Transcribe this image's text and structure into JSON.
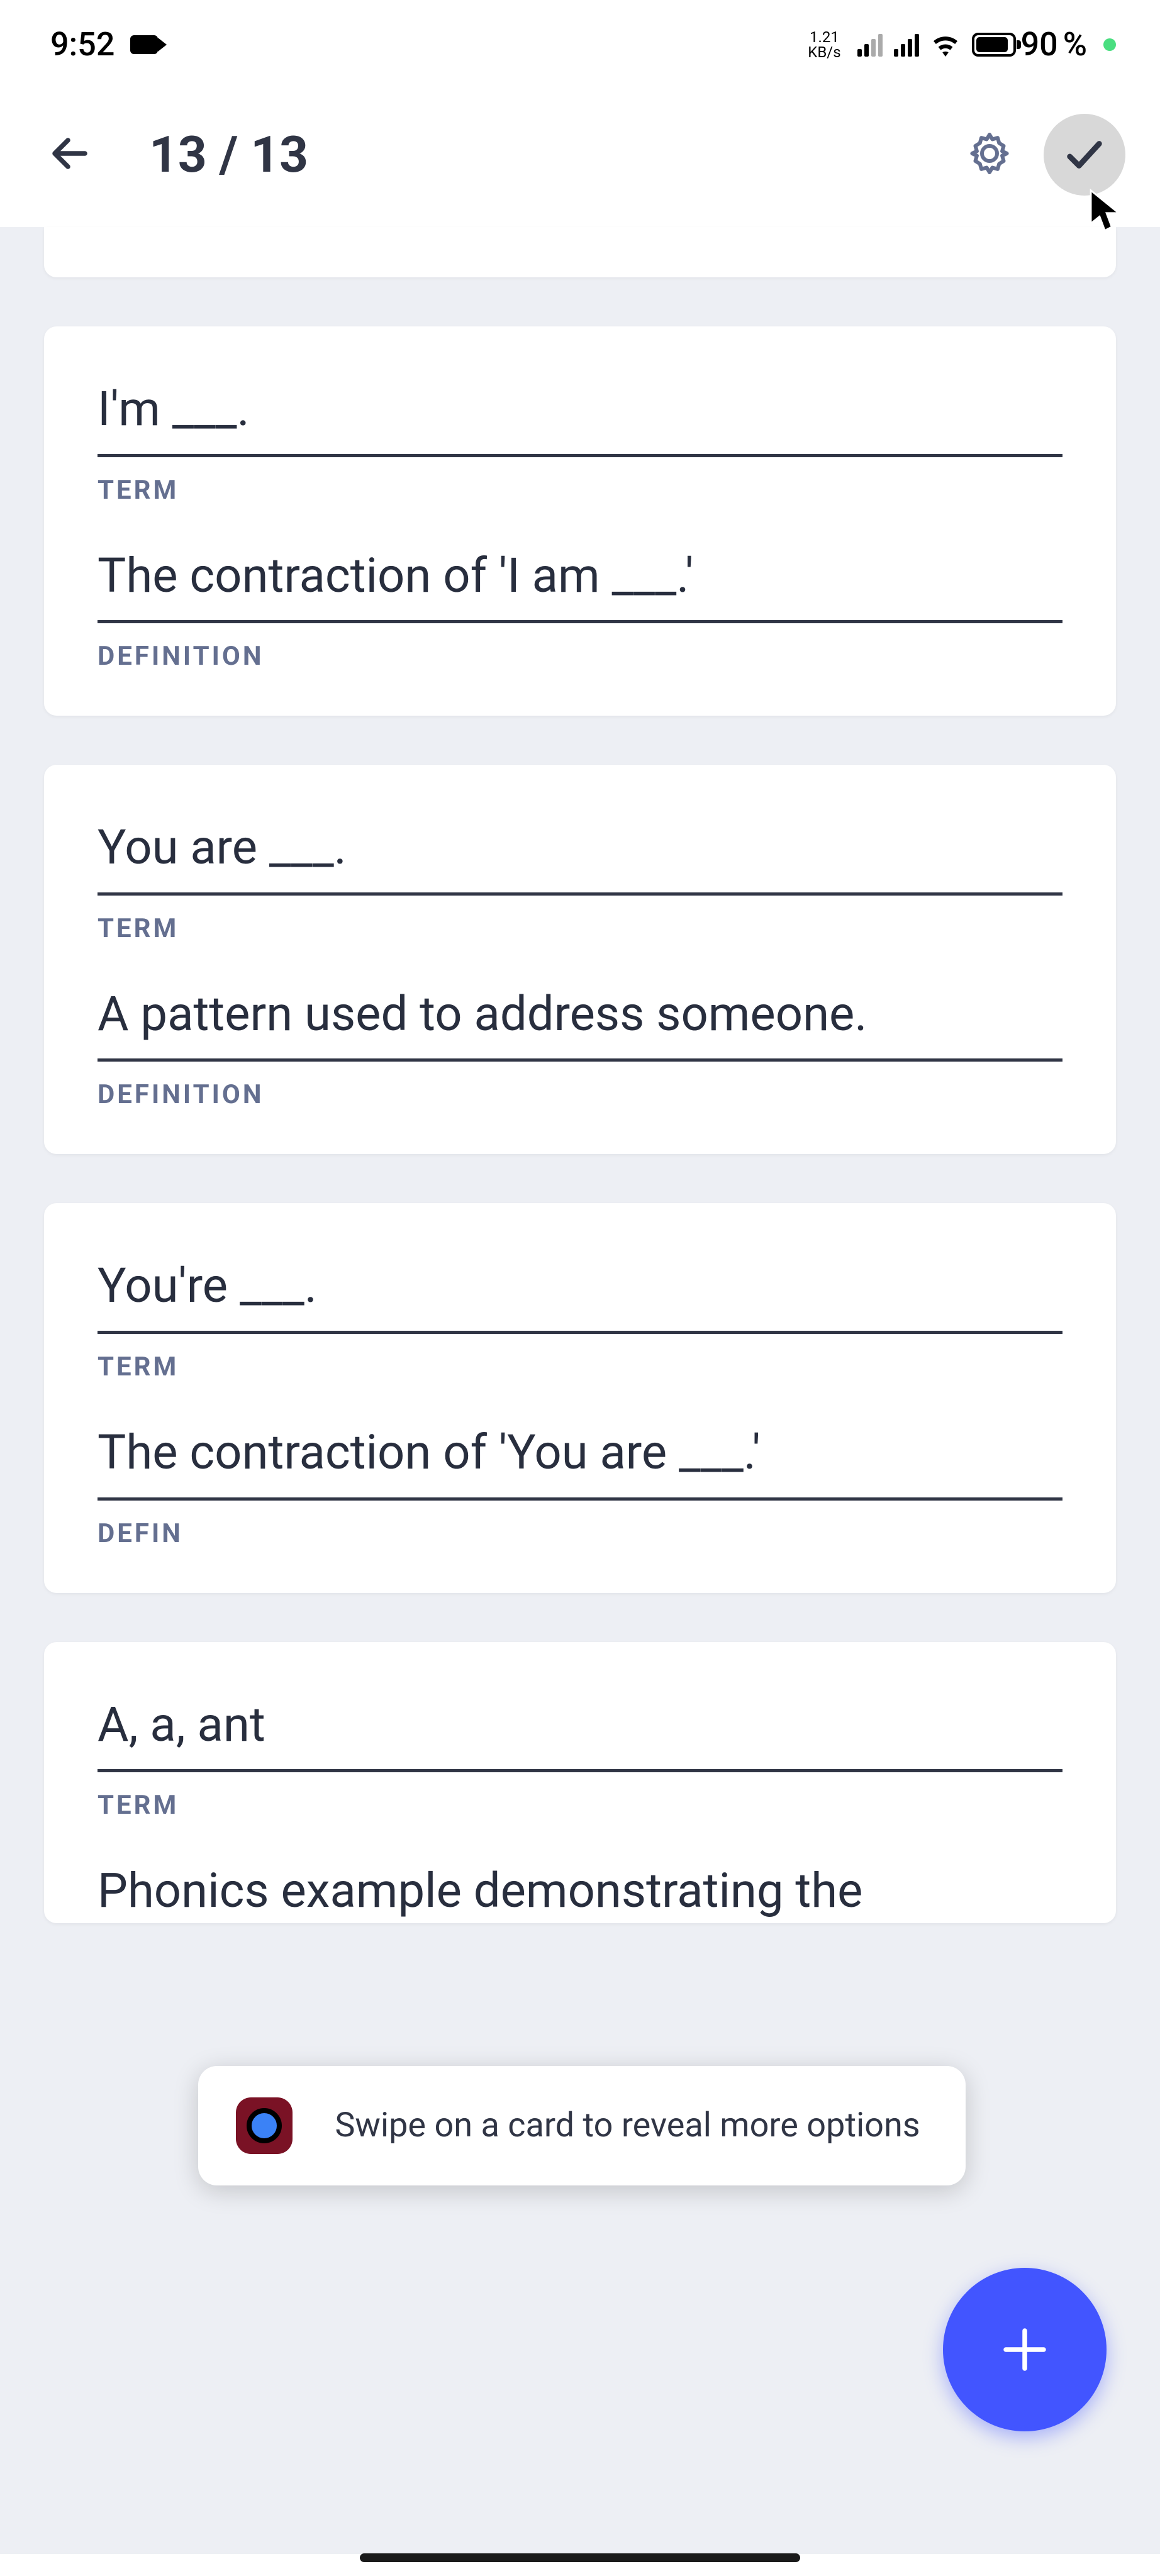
{
  "status": {
    "time": "9:52",
    "net_speed_top": "1.21",
    "net_speed_bottom": "KB/s",
    "battery_pct": "90",
    "battery_unit": "%"
  },
  "header": {
    "counter": "13 / 13"
  },
  "labels": {
    "term": "TERM",
    "definition": "DEFINITION",
    "definition_truncated": "DEFIN"
  },
  "cards": [
    {
      "term": "I'm ___.",
      "definition": "The contraction of 'I am ___.'"
    },
    {
      "term": "You are ___.",
      "definition": "A pattern used to address someone."
    },
    {
      "term": "You're ___.",
      "definition": "The contraction of 'You are ___.'"
    },
    {
      "term": "A, a, ant",
      "definition": "Phonics example demonstrating the"
    }
  ],
  "tooltip": {
    "text": "Swipe on a card to reveal more options"
  }
}
